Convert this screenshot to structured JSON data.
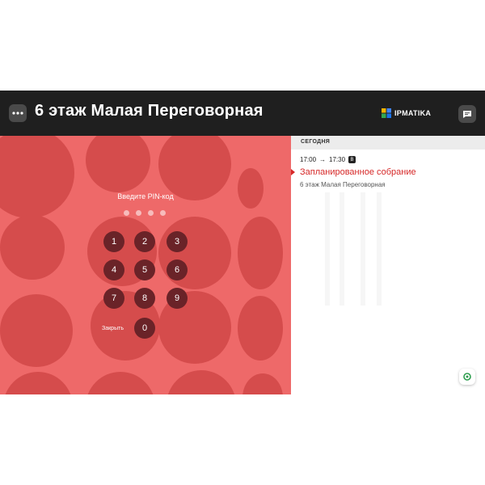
{
  "header": {
    "room_title": "6 этаж Малая Переговорная",
    "brand_name": "IPMATIKA",
    "menu_icon": "more-horizontal-icon",
    "chat_icon": "chat-icon"
  },
  "pin_pad": {
    "prompt": "Введите PIN-код",
    "digits_entered": 0,
    "pin_length": 4,
    "keys": [
      "1",
      "2",
      "3",
      "4",
      "5",
      "6",
      "7",
      "8",
      "9",
      "0"
    ],
    "close_label": "Закрыть"
  },
  "schedule": {
    "day_label": "СЕГОДНЯ",
    "events": [
      {
        "start": "17:00",
        "arrow": "→",
        "end": "17:30",
        "badge": "B",
        "title": "Запланированное собрание",
        "room": "6 этаж Малая Переговорная"
      }
    ]
  },
  "colors": {
    "header_bg": "#1f1f1f",
    "panel_red": "#ee6969",
    "bubble_red": "#d54c4c",
    "key_bg": "#6a2328",
    "event_accent": "#d62828"
  }
}
